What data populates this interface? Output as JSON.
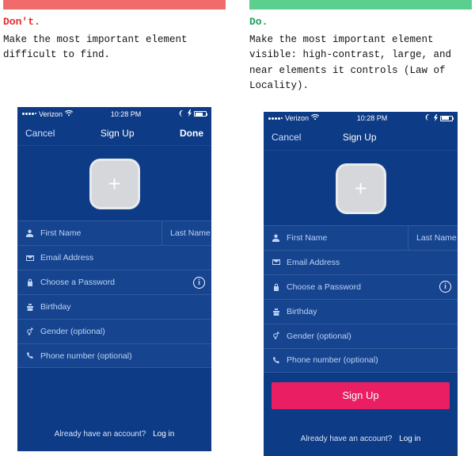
{
  "dont": {
    "tag": "Don't.",
    "desc": "Make the most important element difficult to find."
  },
  "do": {
    "tag": "Do.",
    "desc": "Make the most important element visible: high-contrast, large, and near elements it controls (Law of Locality)."
  },
  "phone": {
    "carrier": "Verizon",
    "time": "10:28 PM",
    "cancel": "Cancel",
    "title": "Sign Up",
    "done": "Done",
    "first_name": "First Name",
    "last_name": "Last Name",
    "email": "Email Address",
    "password": "Choose a Password",
    "birthday": "Birthday",
    "gender": "Gender (optional)",
    "phone_number": "Phone number (optional)",
    "cta": "Sign Up",
    "already": "Already have an account?",
    "login": "Log in"
  }
}
